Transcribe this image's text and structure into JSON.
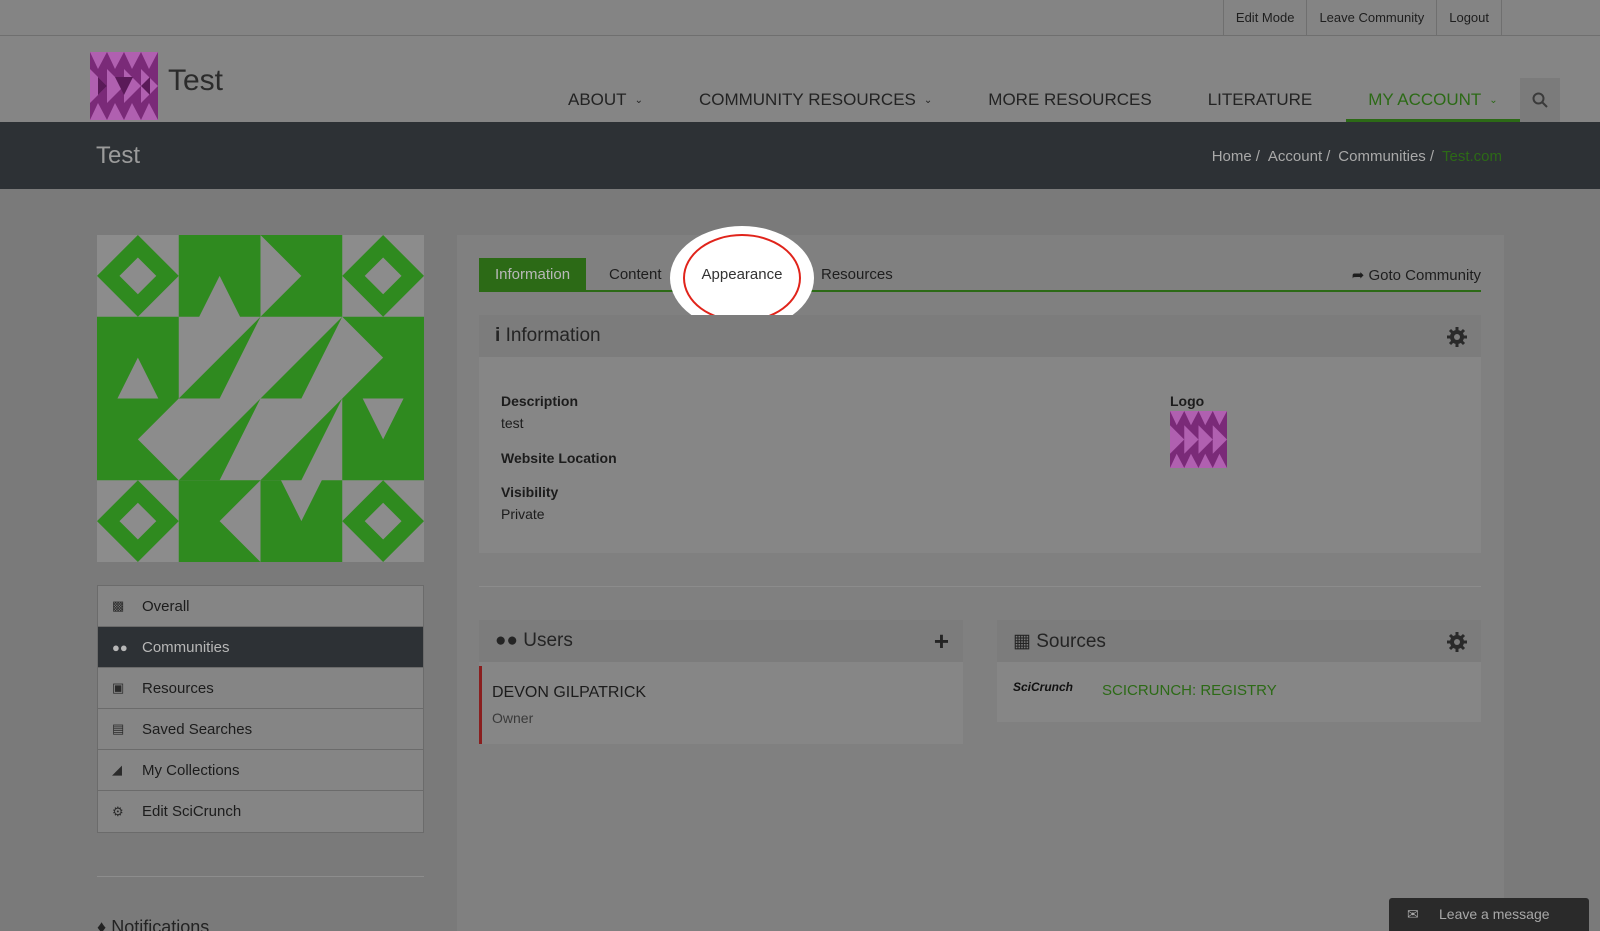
{
  "topbar": {
    "links": [
      "Edit Mode",
      "Leave Community",
      "Logout"
    ]
  },
  "header": {
    "brand": "Test",
    "nav": [
      {
        "label": "ABOUT",
        "dropdown": true
      },
      {
        "label": "COMMUNITY RESOURCES",
        "dropdown": true
      },
      {
        "label": "MORE RESOURCES",
        "dropdown": false
      },
      {
        "label": "LITERATURE",
        "dropdown": false
      },
      {
        "label": "MY ACCOUNT",
        "dropdown": true
      }
    ]
  },
  "titlebar": {
    "title": "Test",
    "breadcrumb": [
      "Home",
      "Account",
      "Communities",
      "Test.com"
    ]
  },
  "sidebar": {
    "items": [
      {
        "label": "Overall",
        "icon": "bar-chart-icon"
      },
      {
        "label": "Communities",
        "icon": "users-icon"
      },
      {
        "label": "Resources",
        "icon": "cubes-icon"
      },
      {
        "label": "Saved Searches",
        "icon": "floppy-icon"
      },
      {
        "label": "My Collections",
        "icon": "folder-open-icon"
      },
      {
        "label": "Edit SciCrunch",
        "icon": "cogs-icon"
      }
    ],
    "notifications": "Notifications"
  },
  "tabs": {
    "items": [
      "Information",
      "Content",
      "Appearance",
      "Resources"
    ],
    "active": "Information",
    "goto": "Goto Community"
  },
  "information": {
    "title": "Information",
    "description_label": "Description",
    "description_value": "test",
    "website_label": "Website Location",
    "visibility_label": "Visibility",
    "visibility_value": "Private",
    "logo_label": "Logo"
  },
  "users": {
    "title": "Users",
    "entries": [
      {
        "name": "DEVON GILPATRICK",
        "role": "Owner"
      }
    ]
  },
  "sources": {
    "title": "Sources",
    "logo_text": "SciCrunch",
    "entries": [
      "SCICRUNCH: REGISTRY"
    ]
  },
  "chat": {
    "label": "Leave a message"
  },
  "colors": {
    "accent": "#2c6a16",
    "dark": "#2d3135",
    "highlight": "#e0241b"
  }
}
